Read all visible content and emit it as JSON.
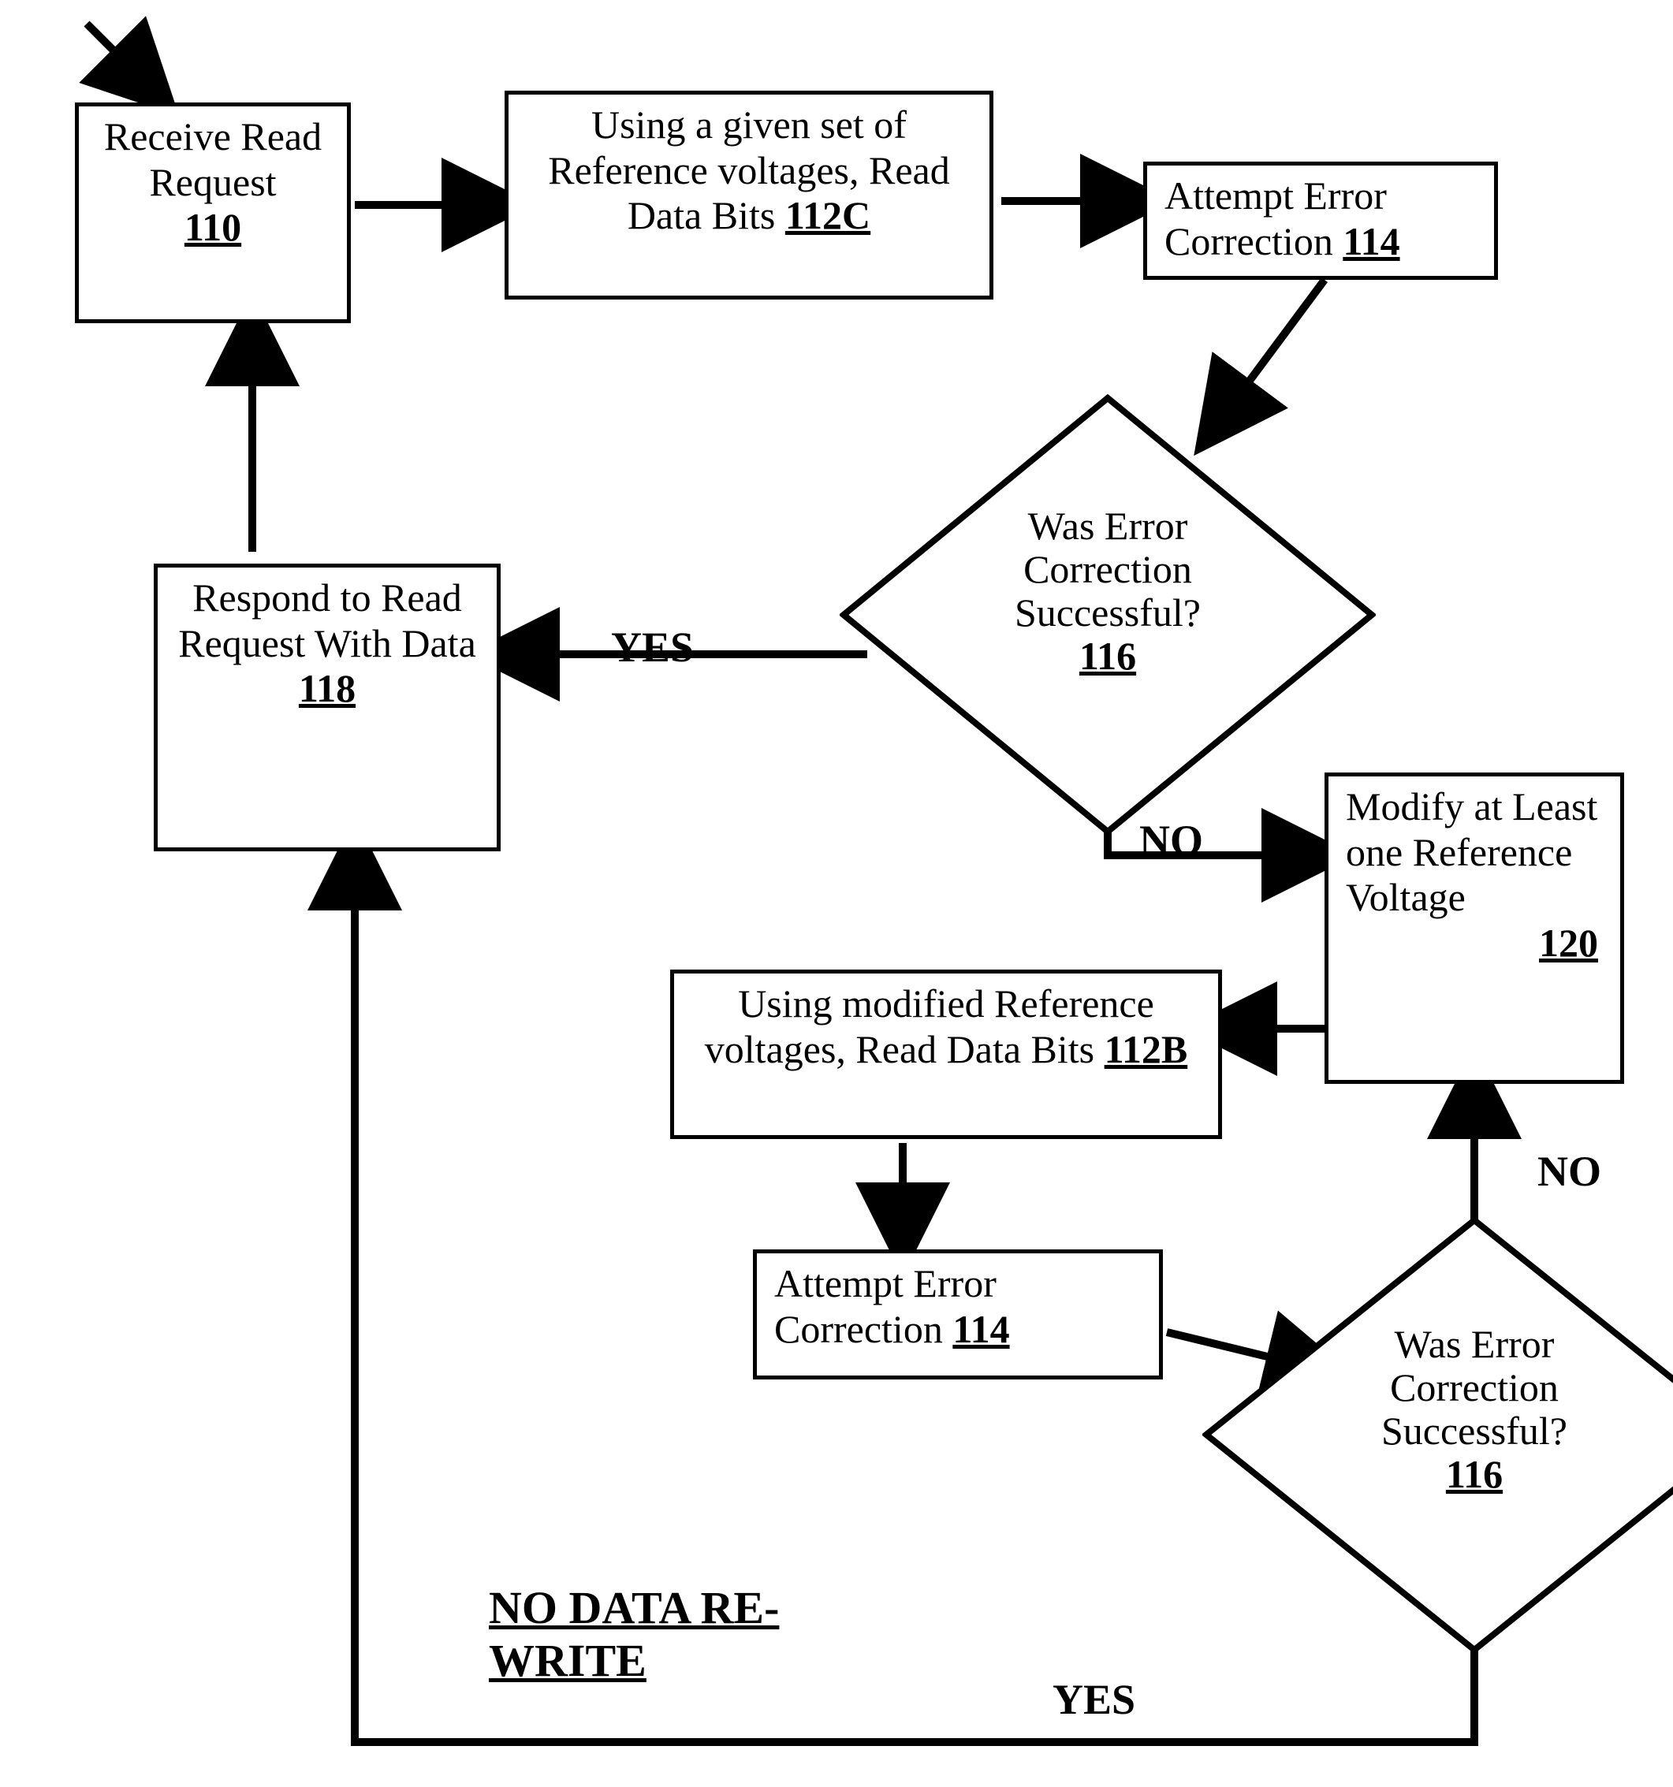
{
  "boxes": {
    "b110": {
      "text": "Receive Read Request",
      "ref": "110"
    },
    "b112c": {
      "text": "Using a given set of Reference voltages, Read Data Bits",
      "ref": "112C"
    },
    "b114a": {
      "text": "Attempt Error Correction",
      "ref": "114"
    },
    "b118": {
      "text": "Respond to Read Request With Data",
      "ref": "118"
    },
    "b120": {
      "text": "Modify at Least one Reference Voltage",
      "ref": "120"
    },
    "b112b": {
      "text": "Using modified Reference voltages, Read Data Bits",
      "ref": "112B"
    },
    "b114b": {
      "text": "Attempt Error Correction",
      "ref": "114"
    }
  },
  "decisions": {
    "d116a": {
      "l1": "Was Error",
      "l2": "Correction",
      "l3": "Successful?",
      "ref": "116"
    },
    "d116b": {
      "l1": "Was Error",
      "l2": "Correction",
      "l3": "Successful?",
      "ref": "116"
    }
  },
  "labels": {
    "yes1": "YES",
    "no1": "NO",
    "no2": "NO",
    "yes2": "YES",
    "note": "NO DATA RE-WRITE"
  }
}
